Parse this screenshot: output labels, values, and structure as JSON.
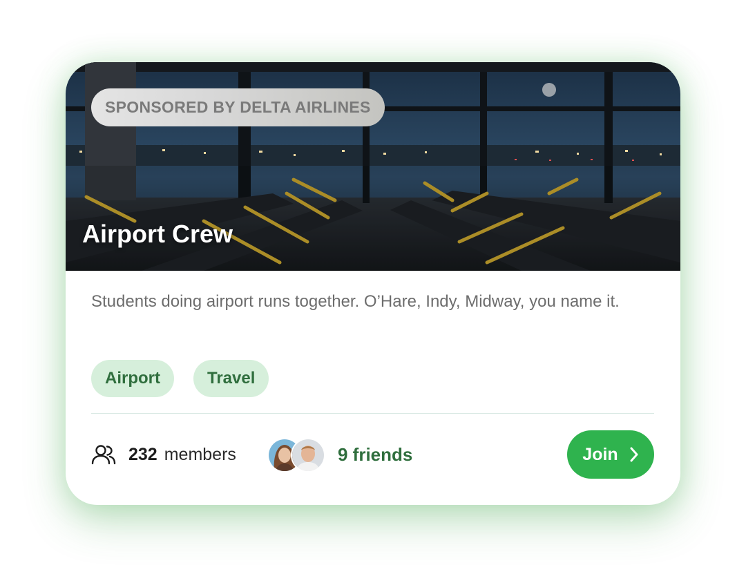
{
  "card": {
    "sponsor": "SPONSORED BY DELTA AIRLINES",
    "title": "Airport Crew",
    "description": "Students doing airport runs together. O’Hare, Indy, Midway, you name it.",
    "tags": [
      "Airport",
      "Travel"
    ],
    "members_count": "232",
    "members_label": "members",
    "friends_label": "9 friends",
    "join_label": "Join"
  },
  "icons": {
    "members": "people-icon",
    "join": "chevron-right-icon"
  },
  "colors": {
    "accent": "#2fb34e",
    "tag_bg": "#d6efdb",
    "tag_text": "#2f6e3d",
    "glow": "#7fd38a"
  }
}
